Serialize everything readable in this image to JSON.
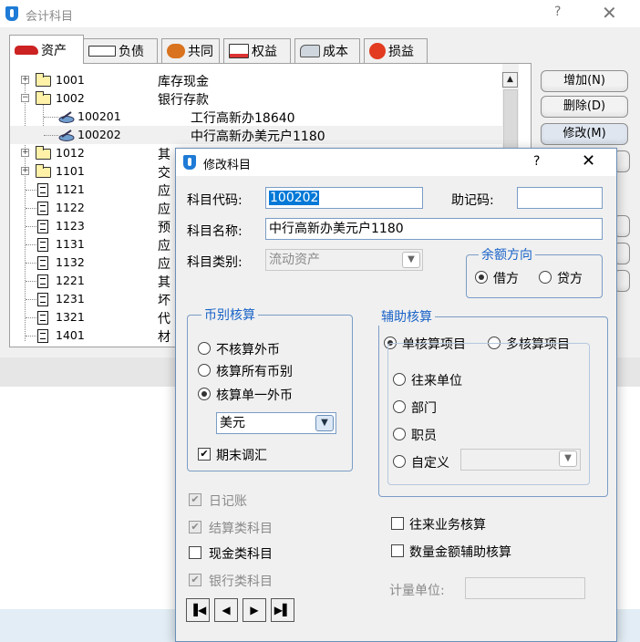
{
  "window": {
    "title": "会计科目",
    "help": "?",
    "close": "✕"
  },
  "tabs": [
    {
      "label": "资产",
      "icon": "car-icon",
      "active": true
    },
    {
      "label": "负债",
      "icon": "keyboard-icon"
    },
    {
      "label": "共同",
      "icon": "people-icon"
    },
    {
      "label": "权益",
      "icon": "certificate-icon"
    },
    {
      "label": "成本",
      "icon": "tap-icon"
    },
    {
      "label": "损益",
      "icon": "fruit-icon"
    }
  ],
  "tree": [
    {
      "code": "1001",
      "name": "库存现金"
    },
    {
      "code": "1002",
      "name": "银行存款"
    },
    {
      "code": "100201",
      "name": "工行高新办18640"
    },
    {
      "code": "100202",
      "name": "中行高新办美元户1180"
    },
    {
      "code": "1012",
      "name": "其"
    },
    {
      "code": "1101",
      "name": "交"
    },
    {
      "code": "1121",
      "name": "应"
    },
    {
      "code": "1122",
      "name": "应"
    },
    {
      "code": "1123",
      "name": "预"
    },
    {
      "code": "1131",
      "name": "应"
    },
    {
      "code": "1132",
      "name": "应"
    },
    {
      "code": "1221",
      "name": "其"
    },
    {
      "code": "1231",
      "name": "坏"
    },
    {
      "code": "1321",
      "name": "代"
    },
    {
      "code": "1401",
      "name": "材"
    }
  ],
  "buttons": {
    "add": "增加(N)",
    "delete": "删除(D)",
    "modify": "修改(M)"
  },
  "dialog": {
    "title": "修改科目",
    "help": "?",
    "close": "✕",
    "code_label": "科目代码:",
    "code_value": "100202",
    "mnemonic_label": "助记码:",
    "mnemonic_value": "",
    "name_label": "科目名称:",
    "name_value": "中行高新办美元户1180",
    "type_label": "科目类别:",
    "type_value": "流动资产",
    "balance": {
      "title": "余额方向",
      "debit": "借方",
      "credit": "贷方",
      "selected": "debit"
    },
    "currency": {
      "title": "币别核算",
      "opt_none": "不核算外币",
      "opt_all": "核算所有币别",
      "opt_single": "核算单一外币",
      "selected": "single",
      "currency_value": "美元",
      "period_end": "期末调汇",
      "period_end_checked": true
    },
    "aux": {
      "title": "辅助核算",
      "single": "单核算项目",
      "multi": "多核算项目",
      "selected": "single",
      "items": [
        "往来单位",
        "部门",
        "职员",
        "自定义"
      ],
      "custom_value": ""
    },
    "checks": [
      {
        "label": "日记账",
        "checked": true,
        "disabled": true
      },
      {
        "label": "结算类科目",
        "checked": true,
        "disabled": true
      },
      {
        "label": "现金类科目",
        "checked": false,
        "disabled": false
      },
      {
        "label": "银行类科目",
        "checked": true,
        "disabled": true
      }
    ],
    "contact_business": "往来业务核算",
    "qty_amount_aux": "数量金额辅助核算",
    "unit_label": "计量单位:",
    "unit_value": "",
    "nav": [
      "first",
      "prev",
      "next",
      "last"
    ]
  },
  "colors": {
    "accent": "#1a63c7",
    "selection": "#0078d7",
    "border": "#7a9cc6"
  }
}
